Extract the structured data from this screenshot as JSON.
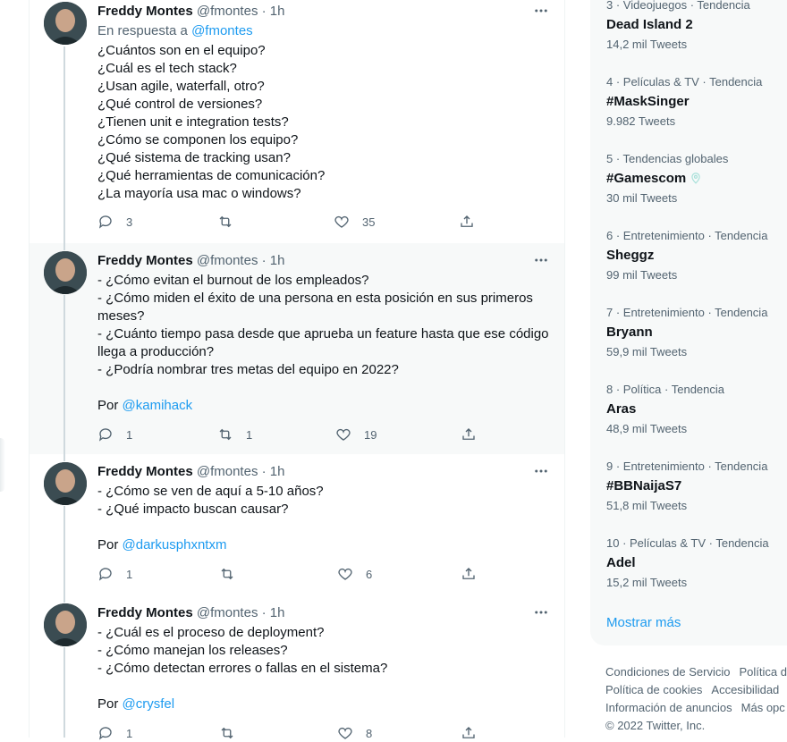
{
  "tweets": [
    {
      "name": "Freddy Montes",
      "handle": "@fmontes",
      "time": "1h",
      "replying_prefix": "En respuesta a ",
      "replying_handle": "@fmontes",
      "text": "¿Cuántos son en el equipo?\n¿Cuál es el tech stack?\n¿Usan agile, waterfall, otro?\n¿Qué control de versiones?\n¿Tienen unit e integration tests?\n¿Cómo se componen los equipo?\n¿Qué sistema de tracking usan?\n¿Qué herramientas de comunicación?\n¿La mayoría usa mac o windows?",
      "replies": "3",
      "retweets": "",
      "likes": "35"
    },
    {
      "name": "Freddy Montes",
      "handle": "@fmontes",
      "time": "1h",
      "text": "- ¿Cómo evitan el burnout de los empleados?\n- ¿Cómo miden el éxito de una persona en esta posición en sus primeros meses?\n- ¿Cuánto tiempo pasa desde que aprueba un feature hasta que ese código llega a producción?\n- ¿Podría nombrar tres metas del equipo en 2022?",
      "by_prefix": "Por ",
      "by_handle": "@kamihack",
      "replies": "1",
      "retweets": "1",
      "likes": "19"
    },
    {
      "name": "Freddy Montes",
      "handle": "@fmontes",
      "time": "1h",
      "text": "- ¿Cómo se ven de aquí a 5-10 años?\n- ¿Qué impacto buscan causar?",
      "by_prefix": "Por ",
      "by_handle": "@darkusphxntxm",
      "replies": "1",
      "retweets": "",
      "likes": "6"
    },
    {
      "name": "Freddy Montes",
      "handle": "@fmontes",
      "time": "1h",
      "text": "- ¿Cuál es el proceso de deployment?\n- ¿Cómo manejan los releases?\n- ¿Cómo detectan errores o fallas en el sistema?",
      "by_prefix": "Por ",
      "by_handle": "@crysfel",
      "replies": "1",
      "retweets": "",
      "likes": "8"
    }
  ],
  "trends": [
    {
      "category": "3 · Videojuegos · Tendencia",
      "name": "Dead Island 2",
      "count": "14,2 mil Tweets"
    },
    {
      "category": "4 · Películas & TV · Tendencia",
      "name": "#MaskSinger",
      "count": "9.982 Tweets"
    },
    {
      "category": "5 · Tendencias globales",
      "name": "#Gamescom",
      "count": "30 mil Tweets"
    },
    {
      "category": "6 · Entretenimiento · Tendencia",
      "name": "Sheggz",
      "count": "99 mil Tweets"
    },
    {
      "category": "7 · Entretenimiento · Tendencia",
      "name": "Bryann",
      "count": "59,9 mil Tweets"
    },
    {
      "category": "8 · Política · Tendencia",
      "name": "Aras",
      "count": "48,9 mil Tweets"
    },
    {
      "category": "9 · Entretenimiento · Tendencia",
      "name": "#BBNaijaS7",
      "count": "51,8 mil Tweets"
    },
    {
      "category": "10 · Películas & TV · Tendencia",
      "name": "Adel",
      "count": "15,2 mil Tweets"
    }
  ],
  "show_more": "Mostrar más",
  "footer": {
    "terms": "Condiciones de Servicio",
    "privacy": "Política de",
    "cookies": "Política de cookies",
    "accessibility": "Accesibilidad",
    "ads_info": "Información de anuncios",
    "more": "Más opc",
    "copyright": "© 2022 Twitter, Inc."
  },
  "colors": {
    "accent": "#1d9bf0",
    "secondary_text": "#536471",
    "highlight_bg": "#f7f9f9"
  }
}
